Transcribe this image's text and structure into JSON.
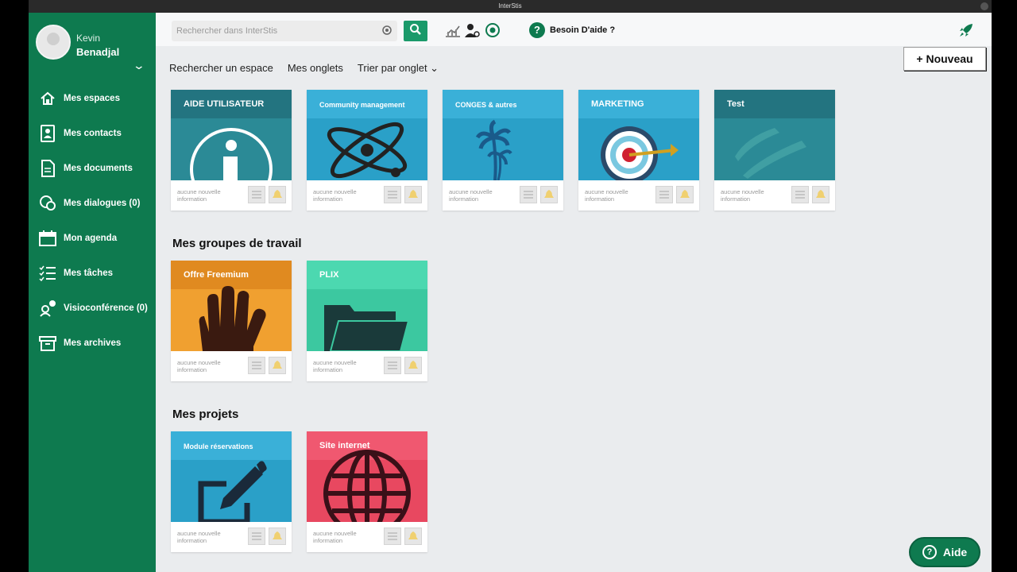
{
  "window": {
    "title": "InterStis"
  },
  "user": {
    "first_name": "Kevin",
    "last_name": "Benadjal"
  },
  "sidebar": {
    "items": [
      {
        "label": "Mes espaces",
        "icon": "home-icon"
      },
      {
        "label": "Mes contacts",
        "icon": "contacts-icon"
      },
      {
        "label": "Mes documents",
        "icon": "document-icon"
      },
      {
        "label": "Mes dialogues (0)",
        "icon": "chat-icon"
      },
      {
        "label": "Mon agenda",
        "icon": "calendar-icon"
      },
      {
        "label": "Mes tâches",
        "icon": "tasks-icon"
      },
      {
        "label": "Visioconférence (0)",
        "icon": "video-conference-icon"
      },
      {
        "label": "Mes archives",
        "icon": "archive-icon"
      }
    ]
  },
  "search": {
    "placeholder": "Rechercher dans InterStis"
  },
  "header": {
    "help_label": "Besoin D'aide ?",
    "new_label": "+ Nouveau"
  },
  "filters": {
    "search_space": "Rechercher un espace",
    "my_tabs": "Mes onglets",
    "sort": "Trier par onglet ⌄"
  },
  "sections": {
    "workgroups": "Mes groupes de travail",
    "projects": "Mes projets"
  },
  "tile_info": "aucune nouvelle information",
  "spaces": [
    {
      "title": "AIDE UTILISATEUR",
      "color": "#2b8a96",
      "band": "#237480",
      "icon": "info-icon"
    },
    {
      "title": "Community management",
      "color": "#2aa0c8",
      "band": "#3ab0d8",
      "icon": "atom-icon"
    },
    {
      "title": "CONGES & autres",
      "color": "#2aa0c8",
      "band": "#3ab0d8",
      "icon": "palm-tree-icon"
    },
    {
      "title": "MARKETING",
      "color": "#2aa0c8",
      "band": "#3ab0d8",
      "icon": "target-icon"
    },
    {
      "title": "Test",
      "color": "#2b8a96",
      "band": "#237480",
      "icon": "abstract-icon"
    }
  ],
  "workgroups": [
    {
      "title": "Offre Freemium",
      "color": "#f0a030",
      "band": "#e08a20",
      "icon": "hand-icon"
    },
    {
      "title": "PLIX",
      "color": "#3cc8a0",
      "band": "#4cd8b0",
      "icon": "folder-icon"
    }
  ],
  "projects": [
    {
      "title": "Module réservations",
      "color": "#2aa0c8",
      "band": "#3ab0d8",
      "icon": "edit-icon"
    },
    {
      "title": "Site internet",
      "color": "#e84860",
      "band": "#f05870",
      "icon": "globe-icon"
    }
  ],
  "aide_button": {
    "label": "Aide"
  }
}
